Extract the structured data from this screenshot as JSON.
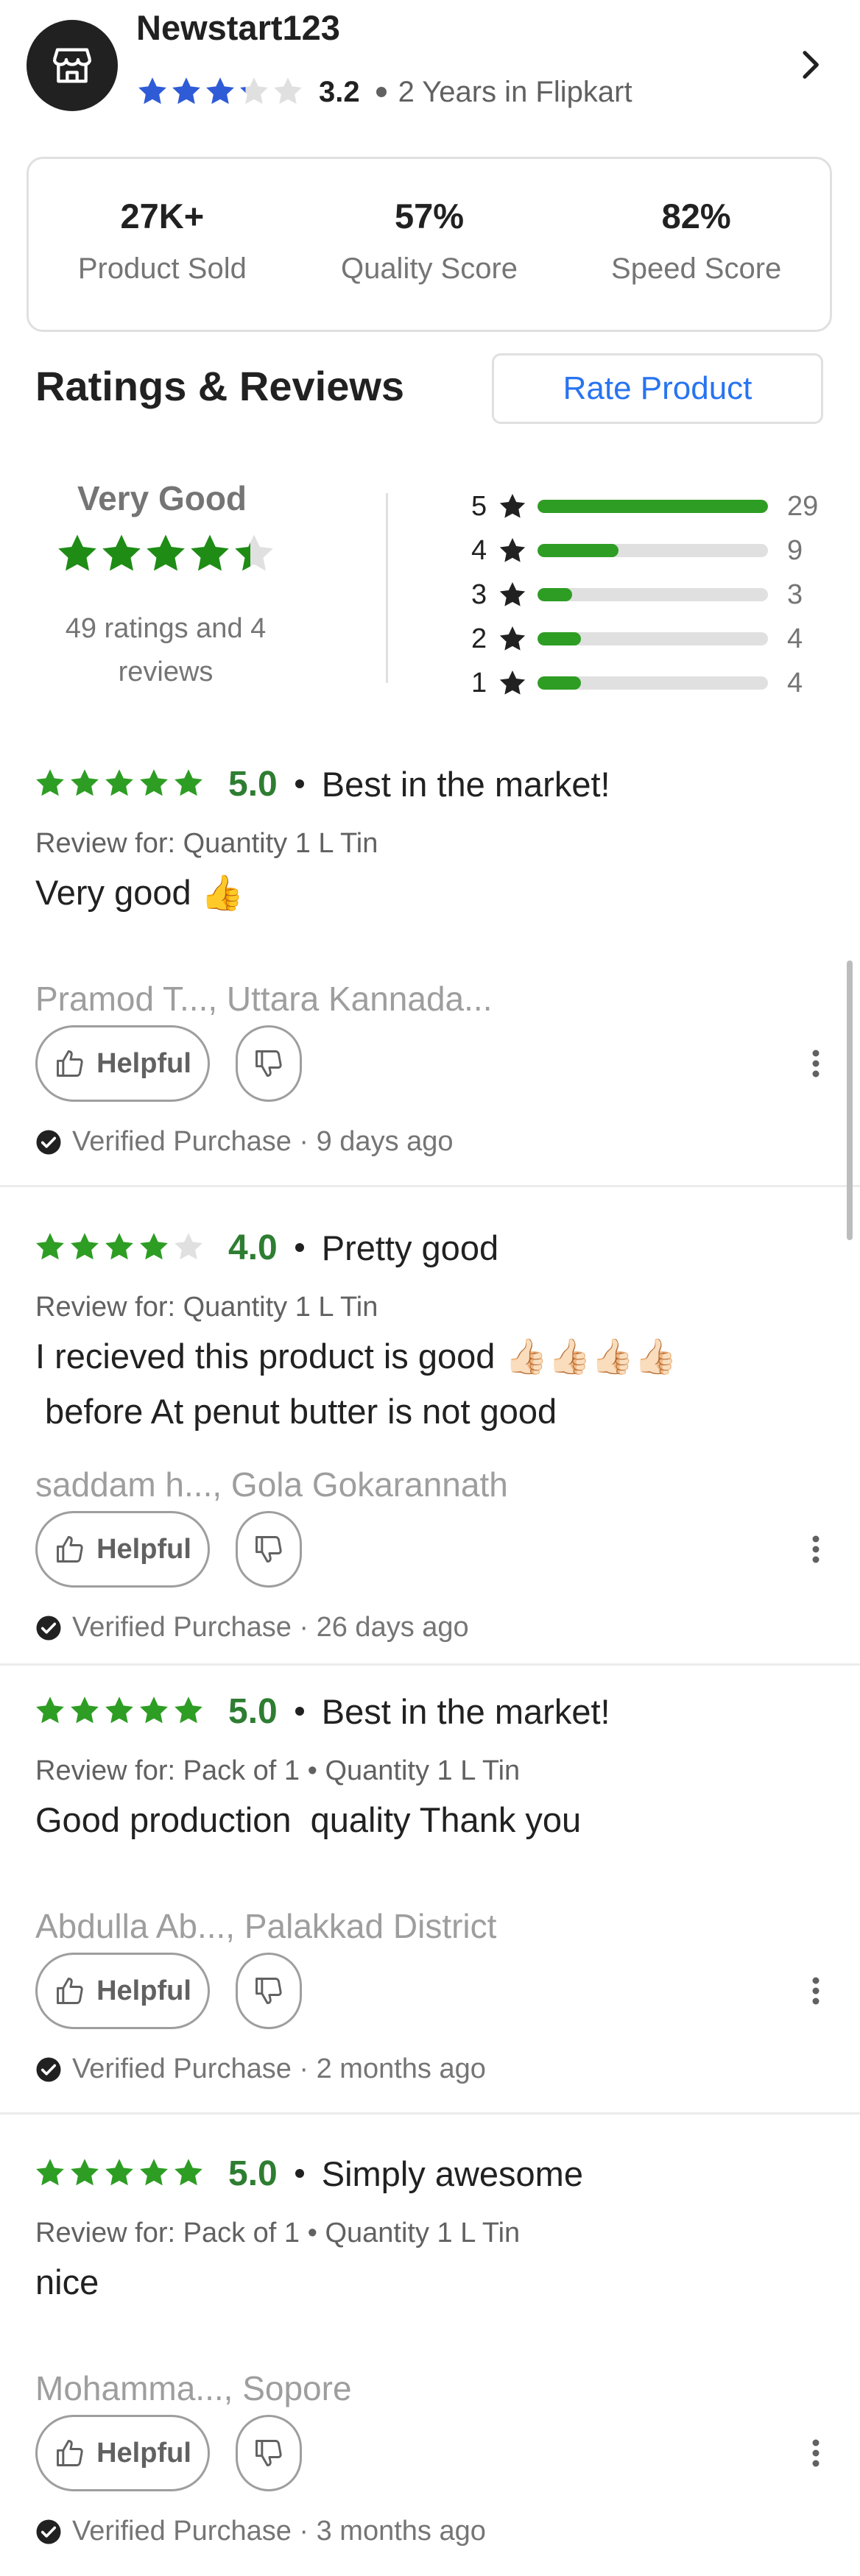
{
  "seller": {
    "name": "Newstart123",
    "rating": "3.2",
    "rating_stars": 3.2,
    "tenure": "2 Years in Flipkart",
    "star_color": "#2f5bd6"
  },
  "stats": [
    {
      "value": "27K+",
      "label": "Product Sold"
    },
    {
      "value": "57%",
      "label": "Quality Score"
    },
    {
      "value": "82%",
      "label": "Speed Score"
    }
  ],
  "ratings_section": {
    "title": "Ratings & Reviews",
    "rate_button": "Rate Product",
    "overall_label": "Very Good",
    "overall_stars": 4.4,
    "count_text": "49 ratings and 4 reviews",
    "distribution": [
      {
        "stars": "5",
        "count": "29",
        "fraction": 1.0
      },
      {
        "stars": "4",
        "count": "9",
        "fraction": 0.35
      },
      {
        "stars": "3",
        "count": "3",
        "fraction": 0.15
      },
      {
        "stars": "2",
        "count": "4",
        "fraction": 0.19
      },
      {
        "stars": "1",
        "count": "4",
        "fraction": 0.19
      }
    ],
    "bar_color": "#2e9d24"
  },
  "reviews": [
    {
      "stars": 5,
      "score": "5.0",
      "title": "Best in the market!",
      "review_for": "Review for: Quantity 1 L Tin",
      "body_lines": [
        "Very good 👍"
      ],
      "author": "Pramod  T..., Uttara Kannada...",
      "helpful": "Helpful",
      "verified": "Verified Purchase · 9 days ago"
    },
    {
      "stars": 4,
      "score": "4.0",
      "title": "Pretty good",
      "review_for": "Review for: Quantity 1 L Tin",
      "body_lines": [
        "I recieved this product is good 👍🏻👍🏻👍🏻👍🏻",
        " before At penut butter is not good"
      ],
      "author": "saddam h..., Gola Gokarannath",
      "helpful": "Helpful",
      "verified": "Verified Purchase · 26 days ago"
    },
    {
      "stars": 5,
      "score": "5.0",
      "title": "Best in the market!",
      "review_for": "Review for: Pack of 1 • Quantity 1 L Tin",
      "body_lines": [
        "Good production  quality Thank you"
      ],
      "author": "Abdulla Ab..., Palakkad District",
      "helpful": "Helpful",
      "verified": "Verified Purchase · 2 months ago"
    },
    {
      "stars": 5,
      "score": "5.0",
      "title": "Simply awesome",
      "review_for": "Review for: Pack of 1 • Quantity 1 L Tin",
      "body_lines": [
        "nice"
      ],
      "author": "Mohamma..., Sopore",
      "helpful": "Helpful",
      "verified": "Verified Purchase · 3 months ago"
    }
  ],
  "review_star_color": "#2e9d24"
}
